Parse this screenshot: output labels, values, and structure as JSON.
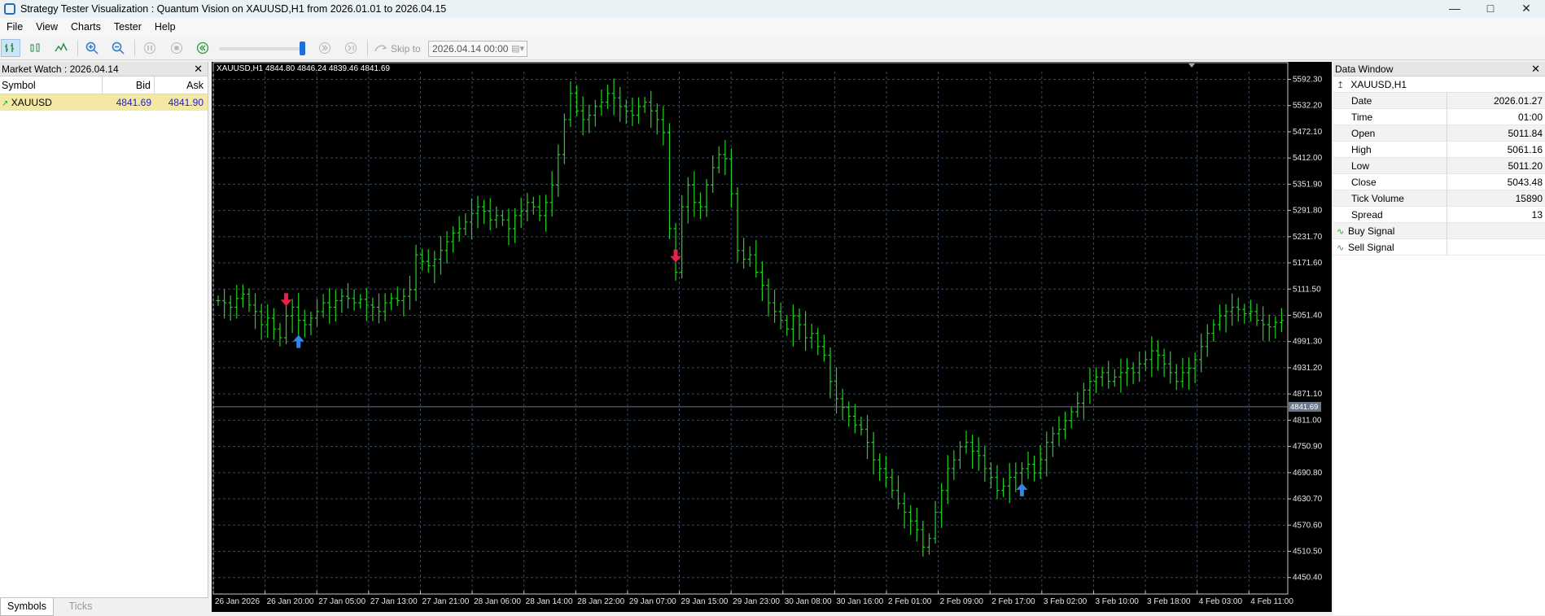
{
  "window": {
    "title": "Strategy Tester Visualization : Quantum Vision on XAUUSD,H1 from 2026.01.01 to 2026.04.15"
  },
  "menu": [
    "File",
    "View",
    "Charts",
    "Tester",
    "Help"
  ],
  "toolbar": {
    "skip_label": "Skip to",
    "skip_value": "2026.04.14 00:00",
    "speed_fraction": 0.92
  },
  "market_watch": {
    "title": "Market Watch : 2026.04.14",
    "columns": [
      "Symbol",
      "Bid",
      "Ask"
    ],
    "rows": [
      {
        "symbol": "XAUUSD",
        "bid": "4841.69",
        "ask": "4841.90"
      }
    ],
    "tabs": [
      "Symbols",
      "Ticks"
    ]
  },
  "chart": {
    "info": "XAUUSD,H1  4844.80 4846.24 4839.46 4841.69",
    "current_price": "4841.69",
    "price_ticks": [
      "5592.30",
      "5532.20",
      "5472.10",
      "5412.00",
      "5351.90",
      "5291.80",
      "5231.70",
      "5171.60",
      "5111.50",
      "5051.40",
      "4991.30",
      "4931.20",
      "4871.10",
      "4811.00",
      "4750.90",
      "4690.80",
      "4630.70",
      "4570.60",
      "4510.50",
      "4450.40"
    ],
    "time_ticks": [
      "26 Jan 2026",
      "26 Jan 20:00",
      "27 Jan 05:00",
      "27 Jan 13:00",
      "27 Jan 21:00",
      "28 Jan 06:00",
      "28 Jan 14:00",
      "28 Jan 22:00",
      "29 Jan 07:00",
      "29 Jan 15:00",
      "29 Jan 23:00",
      "30 Jan 08:00",
      "30 Jan 16:00",
      "2 Feb 01:00",
      "2 Feb 09:00",
      "2 Feb 17:00",
      "3 Feb 02:00",
      "3 Feb 10:00",
      "3 Feb 18:00",
      "4 Feb 03:00",
      "4 Feb 11:00"
    ],
    "colors": {
      "background": "#000000",
      "bars": "#1fd11f",
      "grid": "#3a4a5a",
      "buy_arrow": "#2f86e6",
      "sell_arrow": "#e8204a"
    }
  },
  "chart_data": {
    "type": "ohlc",
    "ylim": [
      4420,
      5610
    ],
    "closes": [
      5085,
      5080,
      5070,
      5090,
      5100,
      5075,
      5060,
      5030,
      5045,
      5020,
      5000,
      5050,
      5070,
      5040,
      5030,
      5045,
      5060,
      5080,
      5070,
      5085,
      5095,
      5090,
      5080,
      5088,
      5075,
      5070,
      5060,
      5080,
      5090,
      5085,
      5095,
      5110,
      5190,
      5175,
      5165,
      5180,
      5200,
      5220,
      5240,
      5250,
      5265,
      5285,
      5300,
      5290,
      5270,
      5280,
      5270,
      5250,
      5280,
      5290,
      5310,
      5300,
      5280,
      5310,
      5350,
      5420,
      5500,
      5560,
      5520,
      5500,
      5510,
      5530,
      5540,
      5560,
      5550,
      5530,
      5520,
      5510,
      5530,
      5540,
      5520,
      5500,
      5470,
      5250,
      5150,
      5300,
      5350,
      5310,
      5300,
      5350,
      5390,
      5420,
      5410,
      5330,
      5200,
      5180,
      5190,
      5150,
      5120,
      5080,
      5060,
      5040,
      5020,
      5050,
      5030,
      5000,
      5010,
      4980,
      4960,
      4900,
      4860,
      4840,
      4820,
      4800,
      4790,
      4760,
      4720,
      4700,
      4680,
      4650,
      4620,
      4600,
      4580,
      4560,
      4520,
      4540,
      4600,
      4650,
      4700,
      4720,
      4750,
      4760,
      4740,
      4730,
      4700,
      4680,
      4650,
      4660,
      4680,
      4690,
      4700,
      4710,
      4690,
      4720,
      4760,
      4780,
      4790,
      4810,
      4830,
      4850,
      4880,
      4900,
      4910,
      4920,
      4900,
      4910,
      4920,
      4930,
      4920,
      4940,
      4950,
      4970,
      4960,
      4940,
      4920,
      4900,
      4920,
      4930,
      4950,
      4980,
      5010,
      5030,
      5050,
      5060,
      5070,
      5065,
      5055,
      5060,
      5040,
      5030,
      5025,
      5035,
      5040
    ],
    "buy_signals": [
      13,
      130
    ],
    "sell_signals": [
      11,
      74
    ]
  },
  "data_window": {
    "title": "Data Window",
    "symbol": "XAUUSD,H1",
    "rows": [
      {
        "key": "Date",
        "value": "2026.01.27"
      },
      {
        "key": "Time",
        "value": "01:00"
      },
      {
        "key": "Open",
        "value": "5011.84"
      },
      {
        "key": "High",
        "value": "5061.16"
      },
      {
        "key": "Low",
        "value": "5011.20"
      },
      {
        "key": "Close",
        "value": "5043.48"
      },
      {
        "key": "Tick Volume",
        "value": "15890"
      },
      {
        "key": "Spread",
        "value": "13"
      }
    ],
    "signals": [
      {
        "key": "Buy Signal",
        "value": ""
      },
      {
        "key": "Sell Signal",
        "value": ""
      }
    ]
  }
}
